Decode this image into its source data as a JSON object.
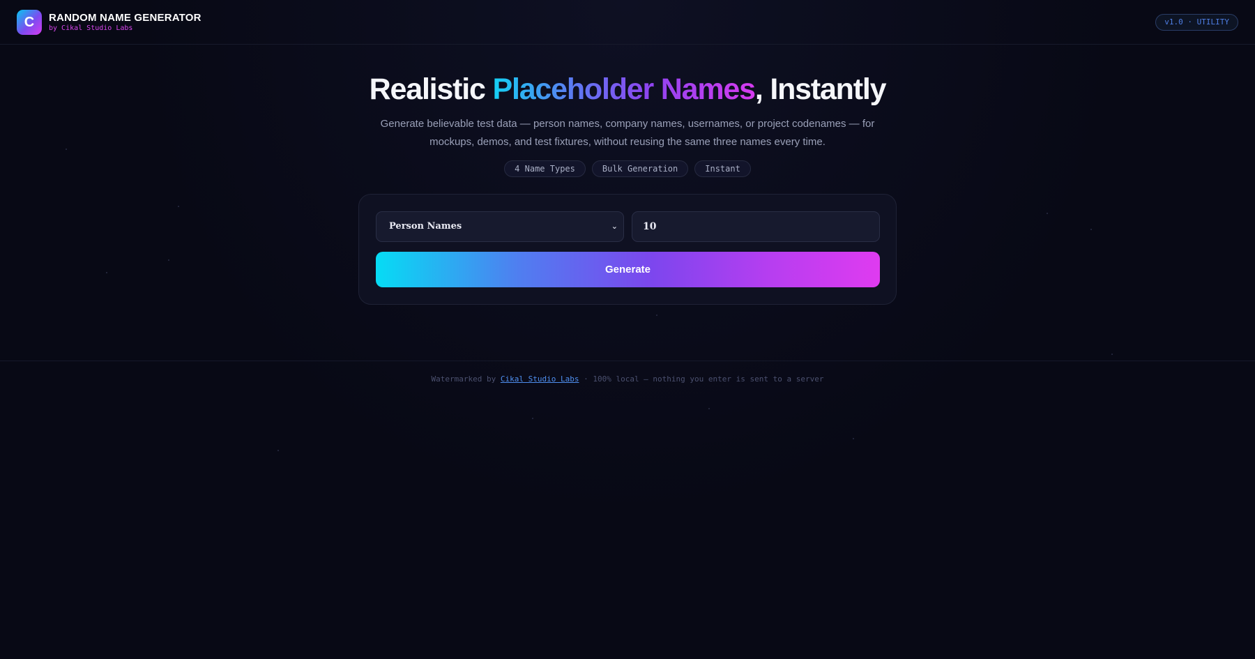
{
  "header": {
    "logo_letter": "C",
    "title": "RANDOM NAME GENERATOR",
    "subtitle": "by Cikal Studio Labs",
    "version": "v1.0 · UTILITY"
  },
  "hero": {
    "title_part1": "Realistic ",
    "title_highlight": "Placeholder Names",
    "title_part2": ", Instantly",
    "description": "Generate believable test data — person names, company names, usernames, or project codenames — for mockups, demos, and test fixtures, without reusing the same three names every time.",
    "tags": [
      "4 Name Types",
      "Bulk Generation",
      "Instant"
    ]
  },
  "form": {
    "type_select": {
      "value": "Person Names"
    },
    "count_input": {
      "value": "10"
    },
    "generate_label": "Generate"
  },
  "footer": {
    "prefix": "Watermarked by ",
    "link_text": "Cikal Studio Labs",
    "suffix": " · 100% local — nothing you enter is sent to a server"
  },
  "colors": {
    "background": "#080915",
    "accent_cyan": "#06dcf4",
    "accent_purple": "#7d46ee",
    "accent_magenta": "#df3bf0",
    "link": "#4f8ff0"
  }
}
